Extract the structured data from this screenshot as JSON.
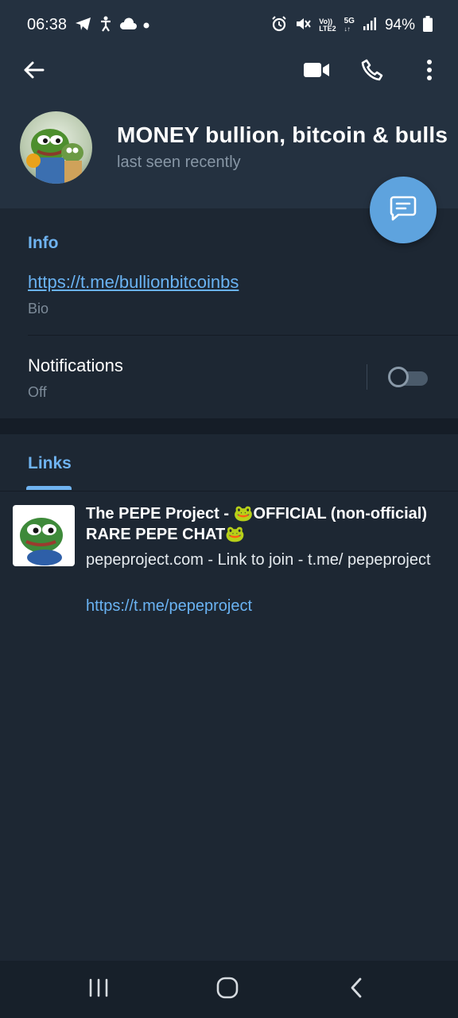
{
  "status_bar": {
    "time": "06:38",
    "battery_percent": "94%",
    "icons_left": [
      "telegram-icon",
      "accessibility-icon",
      "cloud-icon",
      "dot-icon"
    ],
    "icons_right": [
      "alarm-icon",
      "mute-icon",
      "volte-icon",
      "5g-icon",
      "signal-icon",
      "battery-icon"
    ],
    "volte_label": "Vo))",
    "lte_label": "LTE2",
    "net_label": "5G"
  },
  "header": {
    "title": "MONEY    bullion, bitcoin & bullshit",
    "subtitle": "last seen recently",
    "actions": [
      "back-arrow-icon",
      "video-call-icon",
      "phone-icon",
      "more-vertical-icon"
    ]
  },
  "info": {
    "section_label": "Info",
    "bio_link": "https://t.me/bullionbitcoinbs",
    "bio_label": "Bio",
    "notifications_label": "Notifications",
    "notifications_state": "Off",
    "notifications_enabled": false
  },
  "links_tab": {
    "tab_label": "Links",
    "items": [
      {
        "title": "The PEPE Project - 🐸OFFICIAL (non-official) RARE PEPE CHAT🐸",
        "description": "pepeproject.com - Link to join - t.me/ pepeproject",
        "url": "https://t.me/pepeproject"
      }
    ]
  },
  "colors": {
    "header_bg": "#243140",
    "body_bg": "#1d2733",
    "accent": "#6fb3f0",
    "fab": "#5ea3de",
    "muted_text": "#7d8b99"
  }
}
